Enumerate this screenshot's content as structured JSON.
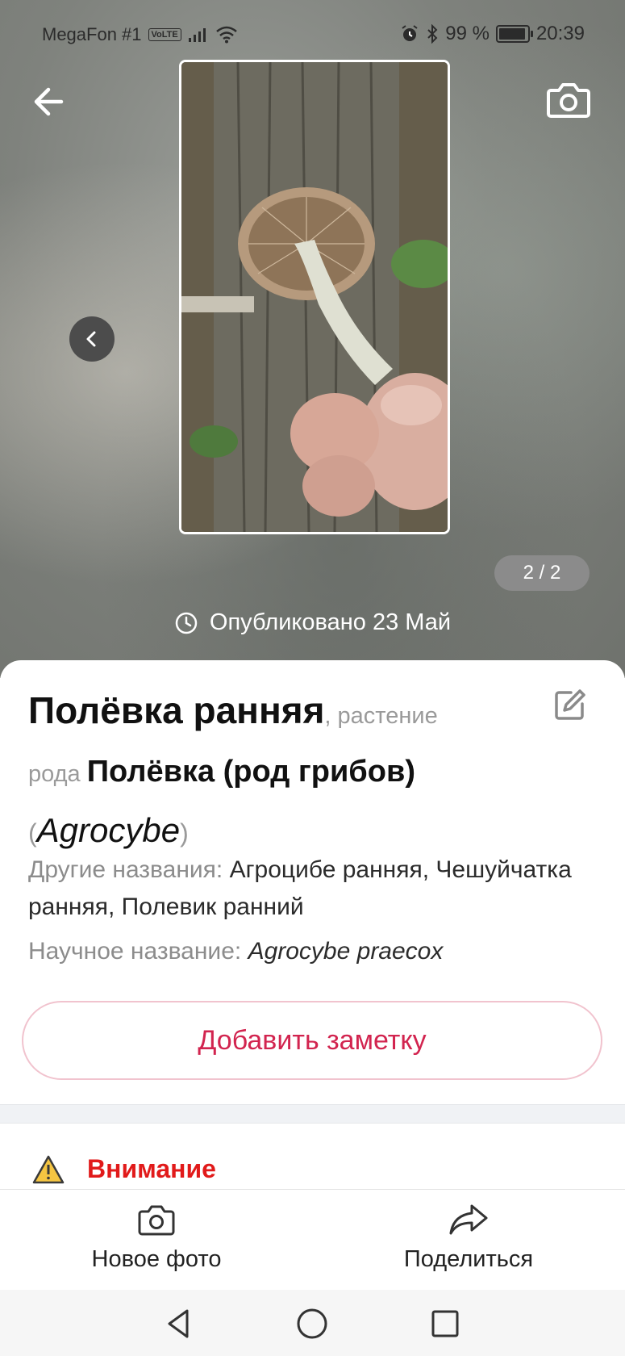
{
  "status_bar": {
    "carrier": "MegaFon #1",
    "volte": "VoLTE",
    "battery": "99 %",
    "time": "20:39"
  },
  "gallery": {
    "counter": "2 / 2",
    "published": "Опубликовано 23 Май"
  },
  "species": {
    "name": "Полёвка ранняя",
    "type_suffix": ", растение",
    "genus_prefix": "рода ",
    "genus": "Полёвка (род грибов)",
    "paren_open": "(",
    "genus_latin": "Agrocybe",
    "paren_close": ")",
    "other_names_label": "Другие названия: ",
    "other_names": "Агроцибе ранняя, Чешуйчатка ранняя, Полевик ранний",
    "scientific_label": "Научное название: ",
    "scientific_name": "Agrocybe praecox"
  },
  "actions": {
    "add_note": "Добавить заметку"
  },
  "warning": {
    "label": "Внимание"
  },
  "bottom_nav": {
    "new_photo": "Новое фото",
    "share": "Поделиться"
  },
  "colors": {
    "accent": "#d2244f",
    "warning": "#e11a1a"
  }
}
